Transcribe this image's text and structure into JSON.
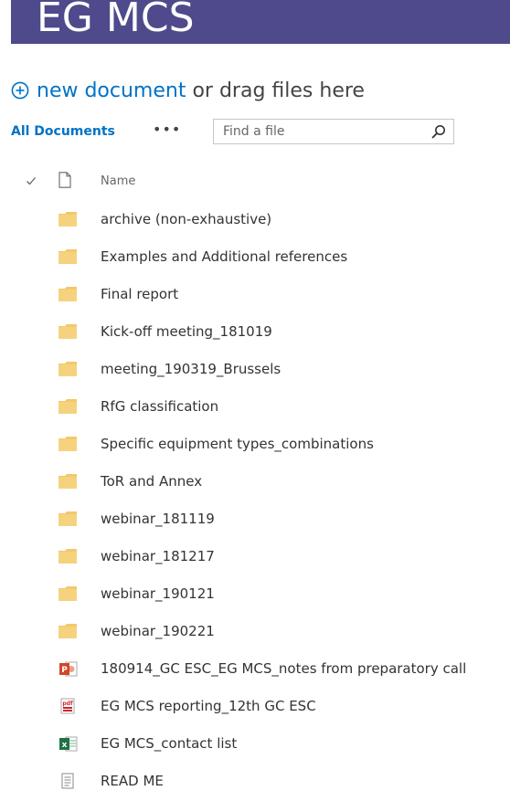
{
  "banner": {
    "title": "EG MCS",
    "color": "#4f4a8b"
  },
  "upload": {
    "new_document_label": "new document",
    "drag_label": "or drag files here",
    "icon": "plus-circle-icon"
  },
  "toolbar": {
    "view_label": "All Documents",
    "more_label": "•••",
    "search_placeholder": "Find a file",
    "search_icon": "search-icon"
  },
  "list_header": {
    "name_label": "Name"
  },
  "items": [
    {
      "name": "archive (non-exhaustive)",
      "type": "folder"
    },
    {
      "name": "Examples and Additional references",
      "type": "folder"
    },
    {
      "name": "Final report",
      "type": "folder"
    },
    {
      "name": "Kick-off meeting_181019",
      "type": "folder"
    },
    {
      "name": "meeting_190319_Brussels",
      "type": "folder"
    },
    {
      "name": "RfG classification",
      "type": "folder"
    },
    {
      "name": "Specific equipment types_combinations",
      "type": "folder"
    },
    {
      "name": "ToR and Annex",
      "type": "folder"
    },
    {
      "name": "webinar_181119",
      "type": "folder"
    },
    {
      "name": "webinar_181217",
      "type": "folder"
    },
    {
      "name": "webinar_190121",
      "type": "folder"
    },
    {
      "name": "webinar_190221",
      "type": "folder"
    },
    {
      "name": "180914_GC ESC_EG MCS_notes from preparatory call",
      "type": "powerpoint"
    },
    {
      "name": "EG MCS reporting_12th GC ESC",
      "type": "pdf"
    },
    {
      "name": "EG MCS_contact list",
      "type": "excel"
    },
    {
      "name": "READ ME",
      "type": "text"
    }
  ],
  "colors": {
    "accent": "#0072c6",
    "folder": "#f2c96b",
    "powerpoint": "#d24726",
    "pdf": "#c8262c",
    "excel": "#207245"
  }
}
